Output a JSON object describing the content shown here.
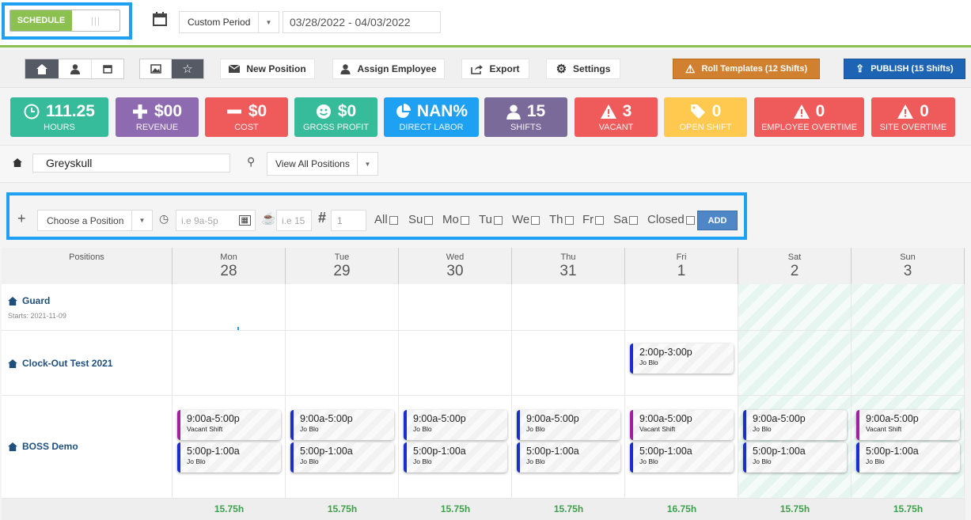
{
  "header": {
    "toggle_label": "SCHEDULE",
    "period_select": "Custom Period",
    "date_range": "03/28/2022 - 04/03/2022"
  },
  "toolbar": {
    "new_position": "New Position",
    "assign_employee": "Assign Employee",
    "export": "Export",
    "settings": "Settings",
    "roll_templates": "Roll Templates (12 Shifts)",
    "publish": "PUBLISH (15 Shifts)"
  },
  "stats": [
    {
      "value": "111.25",
      "label": "HOURS",
      "color": "#37bc9b",
      "icon": "clock-icon"
    },
    {
      "value": "$00",
      "label": "REVENUE",
      "color": "#8e6bb0",
      "icon": "plus-icon"
    },
    {
      "value": "$0",
      "label": "COST",
      "color": "#ef5a5a",
      "icon": "minus-icon"
    },
    {
      "value": "$0",
      "label": "GROSS PROFIT",
      "color": "#37bc9b",
      "icon": "smile-icon"
    },
    {
      "value": "NAN%",
      "label": "DIRECT LABOR",
      "color": "#1ea1f2",
      "icon": "pie-icon"
    },
    {
      "value": "15",
      "label": "SHIFTS",
      "color": "#7a6a9a",
      "icon": "user-icon"
    },
    {
      "value": "3",
      "label": "VACANT",
      "color": "#ef5a5a",
      "icon": "warning-icon"
    },
    {
      "value": "0",
      "label": "OPEN SHIFT",
      "color": "#ffc94f",
      "icon": "tag-icon"
    },
    {
      "value": "0",
      "label": "EMPLOYEE OVERTIME",
      "color": "#ef5a5a",
      "icon": "warning-icon"
    },
    {
      "value": "0",
      "label": "SITE OVERTIME",
      "color": "#ef5a5a",
      "icon": "warning-icon"
    }
  ],
  "filter": {
    "site": "Greyskull",
    "view_positions": "View All Positions"
  },
  "add_form": {
    "position_select": "Choose a Position",
    "time_placeholder": "i.e 9a-5p",
    "break_placeholder": "i.e 15",
    "count": "1",
    "days": [
      "All",
      "Su",
      "Mo",
      "Tu",
      "We",
      "Th",
      "Fr",
      "Sa",
      "Closed"
    ],
    "add_button": "ADD"
  },
  "schedule": {
    "positions_header": "Positions",
    "days": [
      {
        "name": "Mon",
        "date": "28",
        "total": "15.75h"
      },
      {
        "name": "Tue",
        "date": "29",
        "total": "15.75h"
      },
      {
        "name": "Wed",
        "date": "30",
        "total": "15.75h"
      },
      {
        "name": "Thu",
        "date": "31",
        "total": "15.75h"
      },
      {
        "name": "Fri",
        "date": "1",
        "total": "16.75h"
      },
      {
        "name": "Sat",
        "date": "2",
        "total": "15.75h"
      },
      {
        "name": "Sun",
        "date": "3",
        "total": "15.75h"
      }
    ],
    "positions": [
      {
        "name": "Guard",
        "sub": "Starts: 2021-11-09"
      },
      {
        "name": "Clock-Out Test 2021",
        "sub": ""
      },
      {
        "name": "BOSS Demo",
        "sub": ""
      }
    ],
    "clockout_shift": {
      "time": "2:00p-3:00p",
      "who": "Jo Blo"
    },
    "boss_shifts": [
      [
        {
          "time": "9:00a-5:00p",
          "who": "Vacant Shift"
        },
        {
          "time": "5:00p-1:00a",
          "who": "Jo Blo"
        }
      ],
      [
        {
          "time": "9:00a-5:00p",
          "who": "Jo Blo"
        },
        {
          "time": "5:00p-1:00a",
          "who": "Jo Blo"
        }
      ],
      [
        {
          "time": "9:00a-5:00p",
          "who": "Jo Blo"
        },
        {
          "time": "5:00p-1:00a",
          "who": "Jo Blo"
        }
      ],
      [
        {
          "time": "9:00a-5:00p",
          "who": "Jo Blo"
        },
        {
          "time": "5:00p-1:00a",
          "who": "Jo Blo"
        }
      ],
      [
        {
          "time": "9:00a-5:00p",
          "who": "Vacant Shift"
        },
        {
          "time": "5:00p-1:00a",
          "who": "Jo Blo"
        }
      ],
      [
        {
          "time": "9:00a-5:00p",
          "who": "Jo Blo"
        },
        {
          "time": "5:00p-1:00a",
          "who": "Jo Blo"
        }
      ],
      [
        {
          "time": "9:00a-5:00p",
          "who": "Vacant Shift"
        },
        {
          "time": "5:00p-1:00a",
          "who": "Jo Blo"
        }
      ]
    ],
    "colors": {
      "assigned": "#1a2ed0",
      "vacant": "#a020a0"
    }
  }
}
